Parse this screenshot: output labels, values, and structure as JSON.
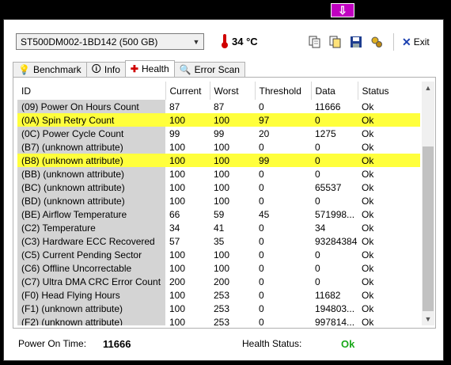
{
  "drive": {
    "name": "ST500DM002-1BD142 (500 GB)"
  },
  "temperature": "34 °C",
  "toolbar": {
    "exit_label": "Exit"
  },
  "tabs": [
    {
      "label": "Benchmark"
    },
    {
      "label": "Info"
    },
    {
      "label": "Health"
    },
    {
      "label": "Error Scan"
    }
  ],
  "table": {
    "columns": [
      "ID",
      "Current",
      "Worst",
      "Threshold",
      "Data",
      "Status"
    ],
    "rows": [
      [
        "(09) Power On Hours Count",
        "87",
        "87",
        "0",
        "11666",
        "Ok"
      ],
      [
        "(0A) Spin Retry Count",
        "100",
        "100",
        "97",
        "0",
        "Ok"
      ],
      [
        "(0C) Power Cycle Count",
        "99",
        "99",
        "20",
        "1275",
        "Ok"
      ],
      [
        "(B7) (unknown attribute)",
        "100",
        "100",
        "0",
        "0",
        "Ok"
      ],
      [
        "(B8) (unknown attribute)",
        "100",
        "100",
        "99",
        "0",
        "Ok"
      ],
      [
        "(BB) (unknown attribute)",
        "100",
        "100",
        "0",
        "0",
        "Ok"
      ],
      [
        "(BC) (unknown attribute)",
        "100",
        "100",
        "0",
        "65537",
        "Ok"
      ],
      [
        "(BD) (unknown attribute)",
        "100",
        "100",
        "0",
        "0",
        "Ok"
      ],
      [
        "(BE) Airflow Temperature",
        "66",
        "59",
        "45",
        "571998...",
        "Ok"
      ],
      [
        "(C2) Temperature",
        "34",
        "41",
        "0",
        "34",
        "Ok"
      ],
      [
        "(C3) Hardware ECC Recovered",
        "57",
        "35",
        "0",
        "93284384",
        "Ok"
      ],
      [
        "(C5) Current Pending Sector",
        "100",
        "100",
        "0",
        "0",
        "Ok"
      ],
      [
        "(C6) Offline Uncorrectable",
        "100",
        "100",
        "0",
        "0",
        "Ok"
      ],
      [
        "(C7) Ultra DMA CRC Error Count",
        "200",
        "200",
        "0",
        "0",
        "Ok"
      ],
      [
        "(F0) Head Flying Hours",
        "100",
        "253",
        "0",
        "11682",
        "Ok"
      ],
      [
        "(F1) (unknown attribute)",
        "100",
        "253",
        "0",
        "194803...",
        "Ok"
      ],
      [
        "(F2) (unknown attribute)",
        "100",
        "253",
        "0",
        "997814...",
        "Ok"
      ]
    ],
    "highlighted_rows": [
      1,
      4
    ]
  },
  "status": {
    "power_on_label": "Power On Time:",
    "power_on_value": "11666",
    "health_label": "Health Status:",
    "health_value": "Ok"
  },
  "colors": {
    "highlight": "#ffff3c",
    "health_ok": "#1aa81a",
    "top_button": "#c000c0"
  }
}
